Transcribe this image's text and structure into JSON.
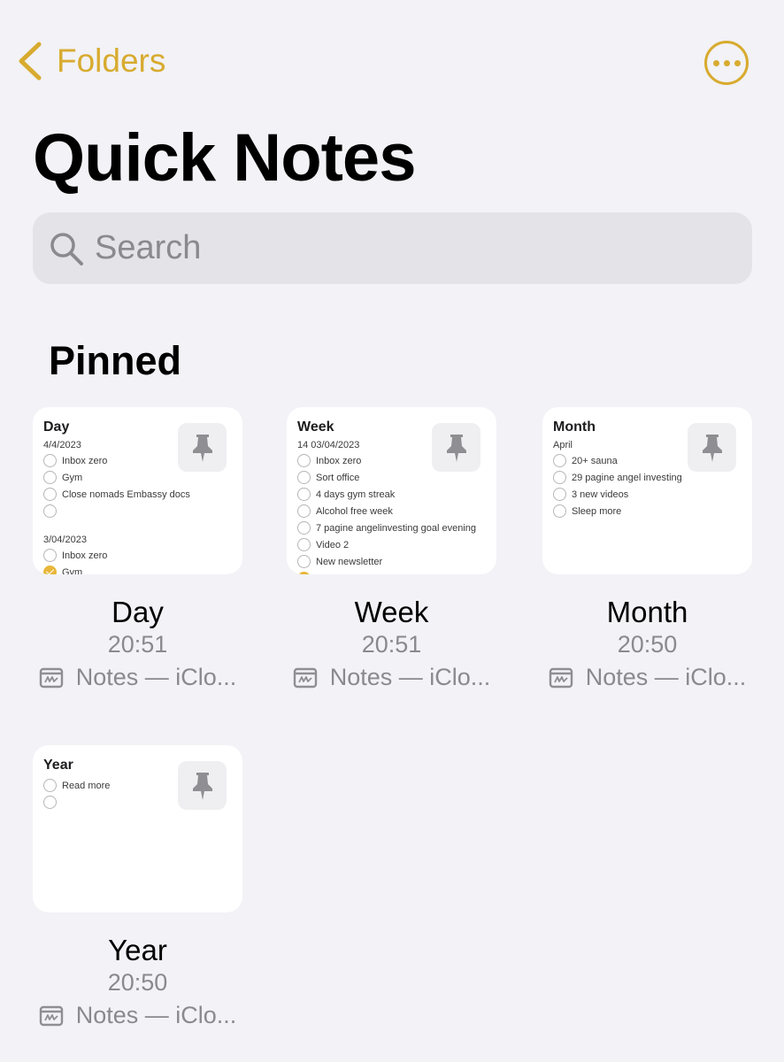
{
  "nav": {
    "back_label": "Folders",
    "more_icon": "ellipsis-circle-icon"
  },
  "page": {
    "title": "Quick Notes"
  },
  "search": {
    "placeholder": "Search",
    "icon": "search-icon"
  },
  "section": {
    "title": "Pinned"
  },
  "colors": {
    "accent": "#d8ab2f",
    "background": "#f2f2f7",
    "secondary_text": "#8a8a8e"
  },
  "notes": [
    {
      "name": "Day",
      "time": "20:51",
      "folder": "Notes — iClo...",
      "preview": {
        "title": "Day",
        "groups": [
          {
            "date": "4/4/2023",
            "items": [
              {
                "text": "Inbox zero",
                "done": false
              },
              {
                "text": "Gym",
                "done": false
              },
              {
                "text": "Close nomads Embassy docs",
                "done": false
              },
              {
                "text": "",
                "done": false
              }
            ]
          },
          {
            "date": "3/04/2023",
            "items": [
              {
                "text": "Inbox zero",
                "done": false
              },
              {
                "text": "Gym",
                "done": true
              }
            ]
          }
        ]
      }
    },
    {
      "name": "Week",
      "time": "20:51",
      "folder": "Notes — iClo...",
      "preview": {
        "title": "Week",
        "groups": [
          {
            "date": "14 03/04/2023",
            "items": [
              {
                "text": "Inbox zero",
                "done": false
              },
              {
                "text": "Sort office",
                "done": false
              },
              {
                "text": "4 days gym streak",
                "done": false
              },
              {
                "text": "Alcohol free week",
                "done": false
              },
              {
                "text": "7 pagine angelinvesting goal evening",
                "done": false
              },
              {
                "text": "Video 2",
                "done": false
              },
              {
                "text": "New newsletter",
                "done": false
              },
              {
                "text": "",
                "done": true
              }
            ]
          }
        ]
      }
    },
    {
      "name": "Month",
      "time": "20:50",
      "folder": "Notes — iClo...",
      "preview": {
        "title": "Month",
        "groups": [
          {
            "date": "April",
            "items": [
              {
                "text": "20+ sauna",
                "done": false
              },
              {
                "text": "29 pagine angel investing",
                "done": false
              },
              {
                "text": "3 new videos",
                "done": false
              },
              {
                "text": "Sleep more",
                "done": false
              }
            ]
          }
        ]
      }
    },
    {
      "name": "Year",
      "time": "20:50",
      "folder": "Notes — iClo...",
      "preview": {
        "title": "Year",
        "groups": [
          {
            "date": "",
            "items": [
              {
                "text": "Read more",
                "done": false
              },
              {
                "text": "",
                "done": false
              }
            ]
          }
        ]
      }
    }
  ]
}
